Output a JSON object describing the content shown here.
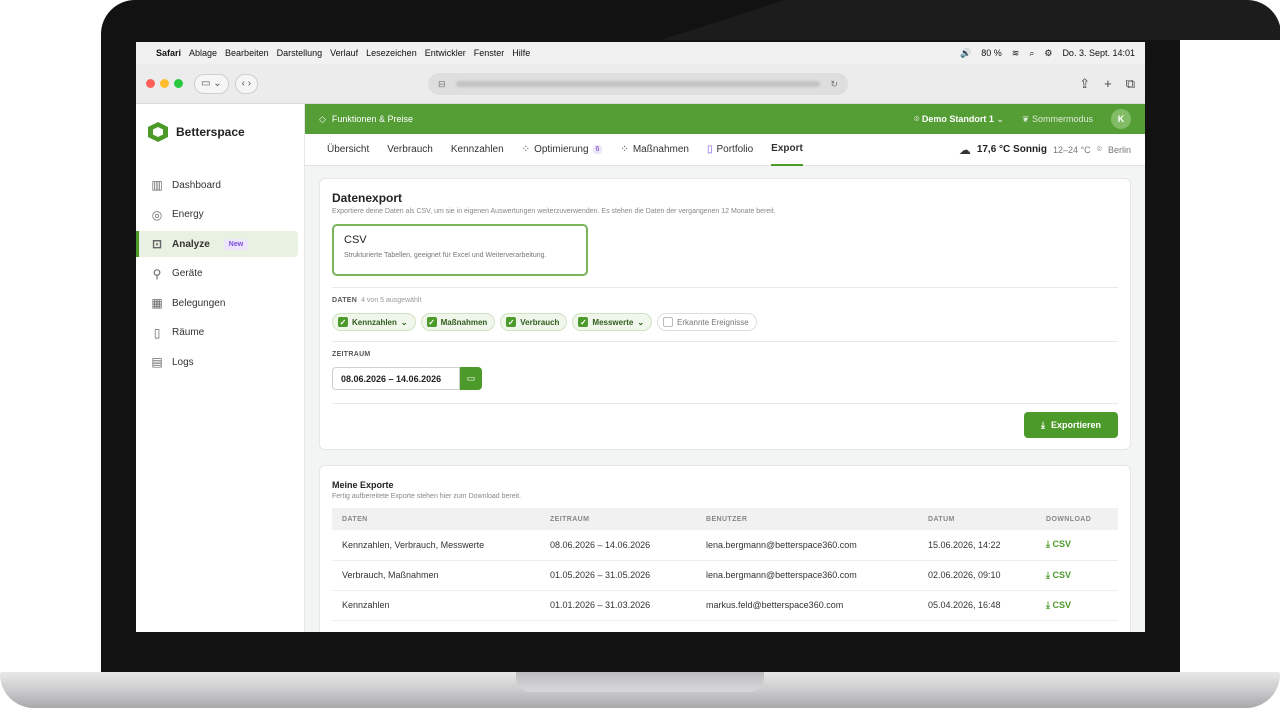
{
  "menubar": {
    "app": "Safari",
    "items": [
      "Ablage",
      "Bearbeiten",
      "Darstellung",
      "Verlauf",
      "Lesezeichen",
      "Entwickler",
      "Fenster",
      "Hilfe"
    ],
    "battery": "80 %",
    "datetime": "Do. 3. Sept. 14:01"
  },
  "colors": {
    "brand": "#4c9a2a",
    "topbar": "#559d35",
    "accent_purple": "#7a4bd9"
  },
  "brand": {
    "name": "Betterspace"
  },
  "sidebar": {
    "items": [
      {
        "label": "Dashboard",
        "icon": "chart-icon"
      },
      {
        "label": "Energy",
        "icon": "energy-icon"
      },
      {
        "label": "Analyze",
        "icon": "analyze-icon",
        "badge": "New",
        "active": true
      },
      {
        "label": "Geräte",
        "icon": "device-icon"
      },
      {
        "label": "Belegungen",
        "icon": "calendar-icon"
      },
      {
        "label": "Räume",
        "icon": "door-icon"
      },
      {
        "label": "Logs",
        "icon": "log-icon"
      }
    ]
  },
  "topbar": {
    "feature_link": "Funktionen & Preise",
    "location": "Demo Standort 1",
    "mode": "Sommermodus",
    "avatar": "K"
  },
  "tabs": [
    {
      "label": "Übersicht"
    },
    {
      "label": "Verbrauch"
    },
    {
      "label": "Kennzahlen"
    },
    {
      "label": "Optimierung",
      "count": "6"
    },
    {
      "label": "Maßnahmen"
    },
    {
      "label": "Portfolio"
    },
    {
      "label": "Export",
      "active": true
    }
  ],
  "weather": {
    "temp": "17,6 °C Sonnig",
    "range": "12–24 °C",
    "city": "Berlin"
  },
  "export": {
    "title": "Datenexport",
    "subtitle": "Exportiere deine Daten als CSV, um sie in eigenen Auswertungen weiterzuverwenden. Es stehen die Daten der vergangenen 12 Monate bereit.",
    "format_title": "CSV",
    "format_desc": "Strukturierte Tabellen, geeignet für Excel und Weiterverarbeitung.",
    "data_label": "DATEN",
    "data_count": "4 von 5 ausgewählt",
    "chips": [
      {
        "label": "Kennzahlen",
        "checked": true,
        "dropdown": true
      },
      {
        "label": "Maßnahmen",
        "checked": true,
        "dropdown": false
      },
      {
        "label": "Verbrauch",
        "checked": true,
        "dropdown": false
      },
      {
        "label": "Messwerte",
        "checked": true,
        "dropdown": true
      },
      {
        "label": "Erkannte Ereignisse",
        "checked": false,
        "dropdown": false
      }
    ],
    "period_label": "ZEITRAUM",
    "period_value": "08.06.2026 – 14.06.2026",
    "button": "Exportieren"
  },
  "my_exports": {
    "title": "Meine Exporte",
    "subtitle": "Fertig aufbereitete Exporte stehen hier zum Download bereit.",
    "columns": [
      "DATEN",
      "ZEITRAUM",
      "BENUTZER",
      "DATUM",
      "DOWNLOAD"
    ],
    "rows": [
      {
        "data": "Kennzahlen, Verbrauch, Messwerte",
        "period": "08.06.2026 – 14.06.2026",
        "user": "lena.bergmann@betterspace360.com",
        "date": "15.06.2026, 14:22",
        "download": "CSV"
      },
      {
        "data": "Verbrauch, Maßnahmen",
        "period": "01.05.2026 – 31.05.2026",
        "user": "lena.bergmann@betterspace360.com",
        "date": "02.06.2026, 09:10",
        "download": "CSV"
      },
      {
        "data": "Kennzahlen",
        "period": "01.01.2026 – 31.03.2026",
        "user": "markus.feld@betterspace360.com",
        "date": "05.04.2026, 16:48",
        "download": "CSV"
      }
    ]
  }
}
